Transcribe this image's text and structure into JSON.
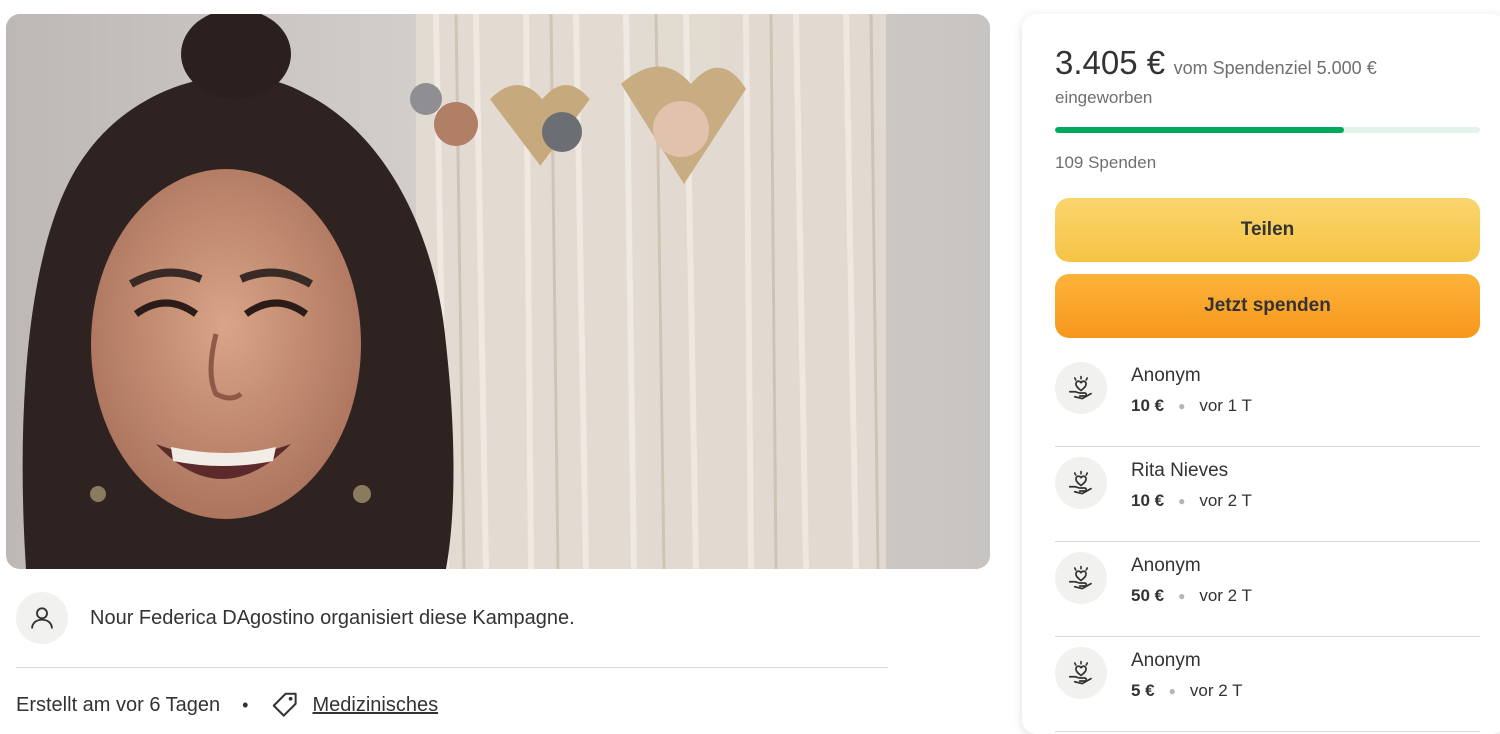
{
  "campaign": {
    "image_alt": "Campaign photo",
    "organizer_text": "Nour Federica DAgostino organisiert diese Kampagne.",
    "created_text": "Erstellt am vor 6 Tagen",
    "meta_separator": "•",
    "category": "Medizinisches"
  },
  "summary": {
    "amount_raised": "3.405 €",
    "goal_text": "vom Spendenziel 5.000 €",
    "raised_label": "eingeworben",
    "progress_fraction": 0.681,
    "donation_count": "109 Spenden"
  },
  "buttons": {
    "share": "Teilen",
    "donate": "Jetzt spenden"
  },
  "donations": [
    {
      "name": "Anonym",
      "amount": "10 €",
      "time": "vor 1 T"
    },
    {
      "name": "Rita Nieves",
      "amount": "10 €",
      "time": "vor 2 T"
    },
    {
      "name": "Anonym",
      "amount": "50 €",
      "time": "vor 2 T"
    },
    {
      "name": "Anonym",
      "amount": "5 €",
      "time": "vor 2 T"
    }
  ],
  "colors": {
    "progress": "#02a95c",
    "share_button": "#f6c445",
    "donate_button": "#f7971c"
  },
  "icons": {
    "organizer": "user-icon",
    "category": "tag-icon",
    "donor": "heart-hand-icon"
  }
}
